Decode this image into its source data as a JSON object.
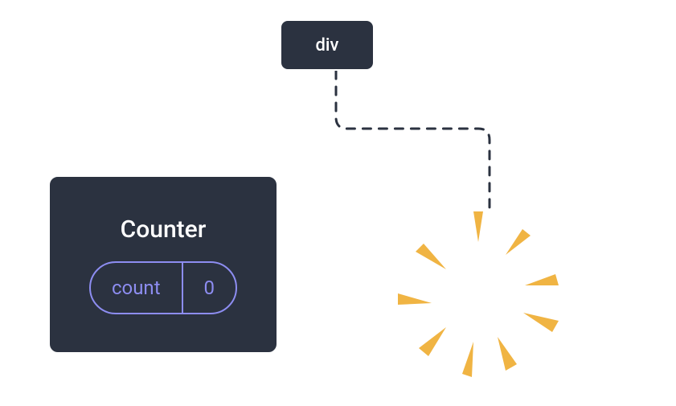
{
  "root_node": {
    "label": "div"
  },
  "counter_node": {
    "title": "Counter",
    "state_label": "count",
    "state_value": "0"
  },
  "colors": {
    "node_bg": "#2b3240",
    "node_border": "#ffffff",
    "accent": "#8d8df1",
    "burst": "#f0b443"
  }
}
